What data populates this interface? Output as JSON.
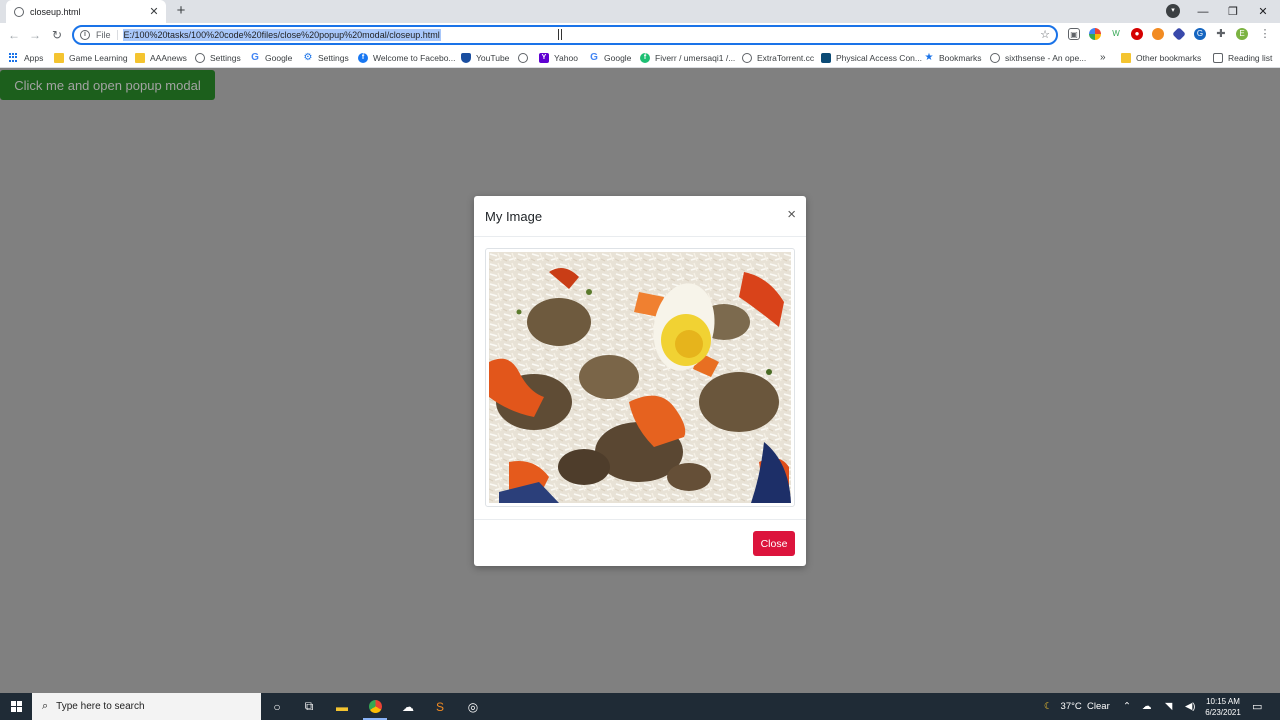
{
  "browser": {
    "tab_title": "closeup.html",
    "tab_close": "✕",
    "new_tab": "+",
    "file_label": "File",
    "url": "E:/100%20tasks/100%20code%20files/close%20popup%20modal/closeup.html"
  },
  "bookmarks": [
    {
      "label": "Apps",
      "icon": "apps"
    },
    {
      "label": "Game Learning",
      "icon": "folder"
    },
    {
      "label": "AAAnews",
      "icon": "folder"
    },
    {
      "label": "Settings",
      "icon": "globe"
    },
    {
      "label": "Google",
      "icon": "g"
    },
    {
      "label": "Settings",
      "icon": "gear"
    },
    {
      "label": "Welcome to Facebo...",
      "icon": "fb"
    },
    {
      "label": "YouTube",
      "icon": "shield"
    },
    {
      "label": "",
      "icon": "globe"
    },
    {
      "label": "Yahoo",
      "icon": "y"
    },
    {
      "label": "Google",
      "icon": "g"
    },
    {
      "label": "Fiverr / umersaqi1 /...",
      "icon": "fiverr"
    },
    {
      "label": "ExtraTorrent.cc",
      "icon": "globe"
    },
    {
      "label": "Physical Access Con...",
      "icon": "pac"
    },
    {
      "label": "Bookmarks",
      "icon": "starb"
    },
    {
      "label": "sixthsense - An ope...",
      "icon": "globe"
    }
  ],
  "bookmarks_overflow": "»",
  "other_bookmarks": "Other bookmarks",
  "reading_list": "Reading list",
  "page": {
    "open_button": "Click me and open popup modal"
  },
  "modal": {
    "title": "My Image",
    "close_x": "×",
    "close_button": "Close"
  },
  "taskbar": {
    "search_placeholder": "Type here to search",
    "weather": "37°C  Clear",
    "time": "10:15 AM",
    "date": "6/23/2021"
  },
  "colors": {
    "overlay": "#808080",
    "open_button": "#1c5f1c",
    "close_button": "#dc143c",
    "url_selection": "#a8c7fa"
  }
}
